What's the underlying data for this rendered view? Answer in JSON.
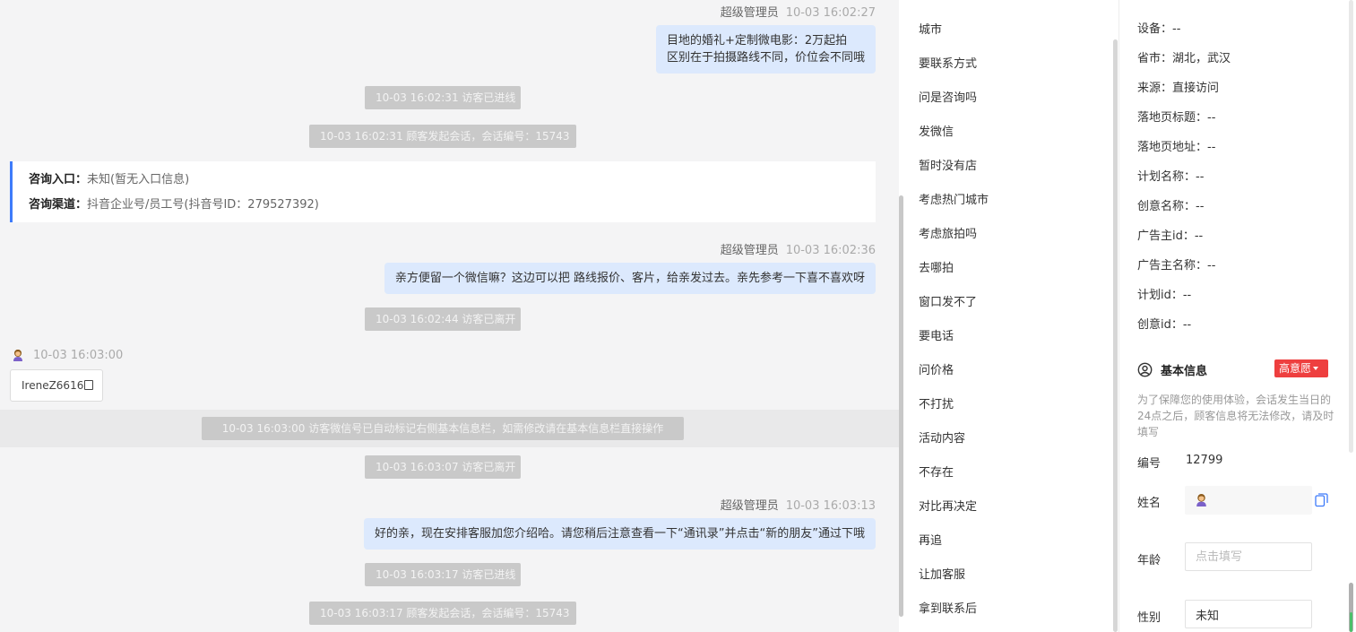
{
  "chat": {
    "m1": {
      "sender": "超级管理员",
      "time": "10-03 16:02:27",
      "lines": [
        "目地的婚礼+定制微电影：2万起拍",
        "区别在于拍摄路线不同，价位会不同哦"
      ]
    },
    "s1": "10-03 16:02:31 访客已进线",
    "s2": "10-03 16:02:31 顾客发起会话，会话编号：15743",
    "entry": {
      "label1": "咨询入口：",
      "value1": "未知(暂无入口信息)",
      "label2": "咨询渠道：",
      "value2": "抖音企业号/员工号(抖音号ID：279527392)"
    },
    "m2": {
      "sender": "超级管理员",
      "time": "10-03 16:02:36",
      "text": "亲方便留一个微信嘛？这边可以把  路线报价、客片，给亲发过去。亲先参考一下喜不喜欢呀"
    },
    "s3": "10-03 16:02:44 访客已离开",
    "visitor": {
      "time": "10-03 16:03:00",
      "wechat": "IreneZ6616"
    },
    "s4": "10-03 16:03:00 访客微信号已自动标记右侧基本信息栏，如需修改请在基本信息栏直接操作",
    "s5": "10-03 16:03:07 访客已离开",
    "m3": {
      "sender": "超级管理员",
      "time": "10-03 16:03:13",
      "text": "好的亲，现在安排客服加您介绍哈。请您稍后注意查看一下“通讯录”并点击“新的朋友”通过下哦"
    },
    "s6": "10-03 16:03:17 访客已进线",
    "s7": "10-03 16:03:17 顾客发起会话，会话编号：15743"
  },
  "phrases": [
    "城市",
    "要联系方式",
    "问是咨询吗",
    "发微信",
    "暂时没有店",
    "考虑热门城市",
    "考虑旅拍吗",
    "去哪拍",
    "窗口发不了",
    "要电话",
    "问价格",
    "不打扰",
    "活动内容",
    "不存在",
    "对比再决定",
    "再追",
    "让加客服",
    "拿到联系后"
  ],
  "info": {
    "rows": [
      "设备：--",
      "省市：湖北，武汉",
      "来源：直接访问",
      "落地页标题：--",
      "落地页地址：--",
      "计划名称：--",
      "创意名称：--",
      "广告主id：--",
      "广告主名称：--",
      "计划id：--",
      "创意id：--"
    ],
    "basic_title": "基本信息",
    "intent": "高意愿",
    "notice": "为了保障您的使用体验，会话发生当日的24点之后，顾客信息将无法修改，请及时填写",
    "id_label": "编号",
    "id_value": "12799",
    "name_label": "姓名",
    "age_label": "年龄",
    "age_placeholder": "点击填写",
    "gender_label": "性别",
    "gender_value": "未知"
  },
  "colors": {
    "accent": "#3e7bfa",
    "bubble": "#dce9fd",
    "badge": "#ee3f3f",
    "system": "#c9c9c9"
  }
}
